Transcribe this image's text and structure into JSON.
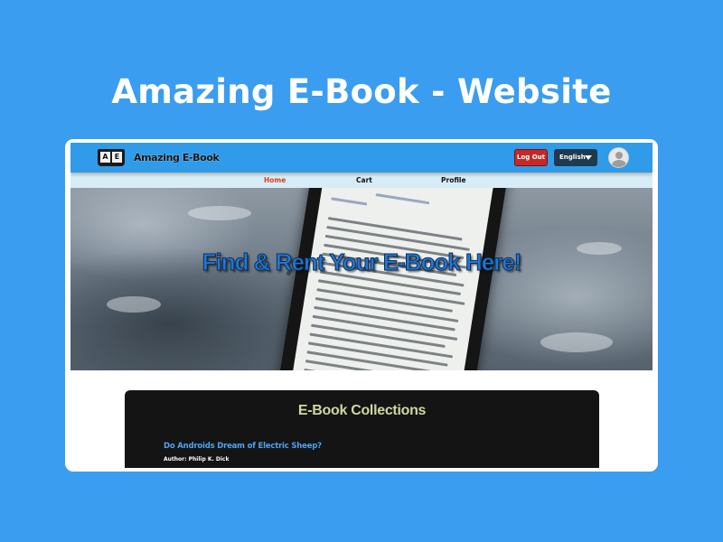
{
  "showcase": {
    "title": "Amazing E-Book - Website"
  },
  "header": {
    "logo_icon": "open-book-icon",
    "logo_letters": [
      "A",
      "E"
    ],
    "logo_text": "Amazing E-Book",
    "logout_label": "Log Out",
    "language": "English",
    "avatar_icon": "user-avatar-icon",
    "colors": {
      "background": "#2f9be9",
      "logout": "#c62828",
      "language": "#1f3a4d"
    }
  },
  "nav": {
    "items": [
      {
        "label": "Home",
        "active": true
      },
      {
        "label": "Cart",
        "active": false
      },
      {
        "label": "Profile",
        "active": false
      }
    ],
    "active_color": "#d84315"
  },
  "hero": {
    "title": "Find & Rent Your E-Book Here!",
    "title_color": "#2277d6"
  },
  "collections": {
    "title": "E-Book Collections",
    "books": [
      {
        "title": "Do Androids Dream of Electric Sheep?",
        "author": "Author: Philip K. Dick"
      }
    ]
  }
}
